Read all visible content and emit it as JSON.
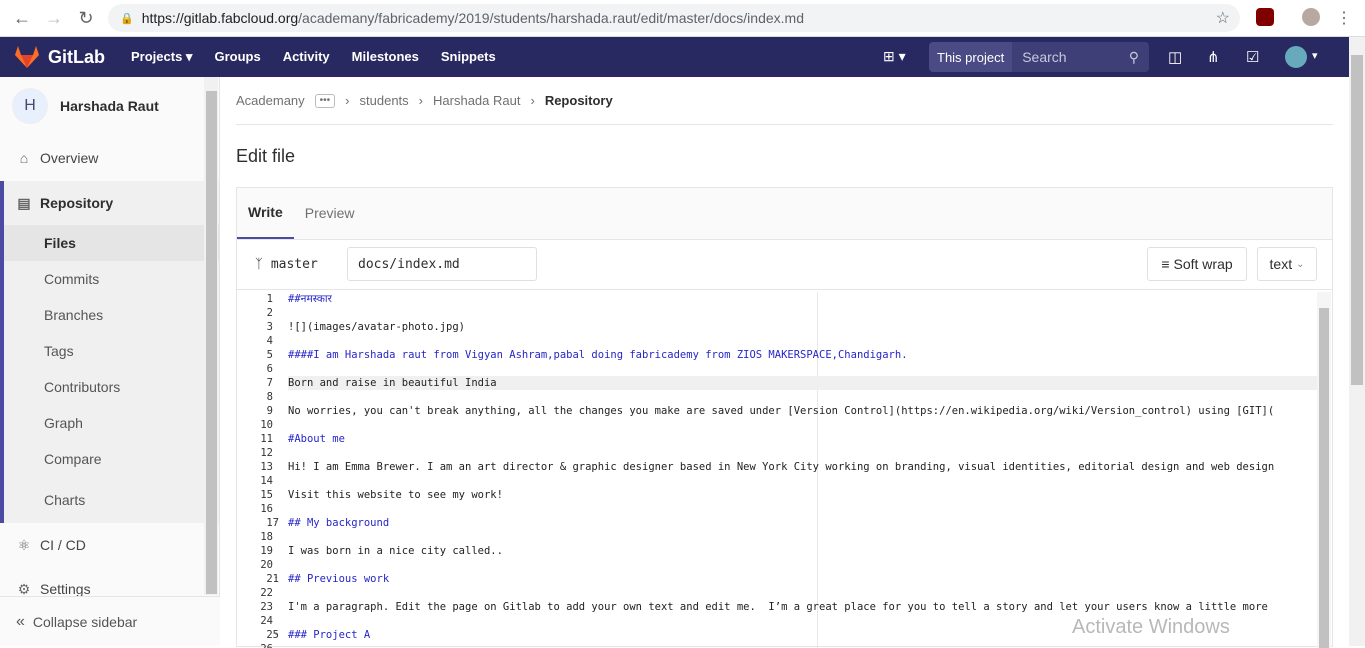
{
  "browser": {
    "url_host": "https://gitlab.fabcloud.org",
    "url_path": "/academany/fabricademy/2019/students/harshada.raut/edit/master/docs/index.md"
  },
  "gitlab": {
    "brand": "GitLab",
    "nav": [
      "Projects",
      "Groups",
      "Activity",
      "Milestones",
      "Snippets"
    ],
    "search_scope": "This project",
    "search_placeholder": "Search",
    "bar_color": "#292961"
  },
  "sidebar": {
    "avatar_letter": "H",
    "project_name": "Harshada Raut",
    "overview": "Overview",
    "repository": "Repository",
    "repo_items": [
      "Files",
      "Commits",
      "Branches",
      "Tags",
      "Contributors",
      "Graph",
      "Compare",
      "Charts"
    ],
    "cicd": "CI / CD",
    "settings": "Settings",
    "collapse": "Collapse sidebar"
  },
  "breadcrumb": {
    "items": [
      "Academany",
      "students",
      "Harshada Raut"
    ],
    "current": "Repository"
  },
  "page_title": "Edit file",
  "editor": {
    "tabs": [
      "Write",
      "Preview"
    ],
    "branch": "master",
    "filename": "docs/index.md",
    "soft_wrap": "Soft wrap",
    "file_type": "text",
    "lines": [
      "##नमस्कार",
      "",
      "![](images/avatar-photo.jpg)",
      "",
      "####I am Harshada raut from Vigyan Ashram,pabal doing fabricademy from ZIOS MAKERSPACE,Chandigarh.",
      "",
      "Born and raise in beautiful India",
      "",
      "No worries, you can't break anything, all the changes you make are saved under [Version Control](https://en.wikipedia.org/wiki/Version_control) using [GIT](",
      "",
      "#About me",
      "",
      "Hi! I am Emma Brewer. I am an art director & graphic designer based in New York City working on branding, visual identities, editorial design and web design",
      "",
      "Visit this website to see my work!",
      "",
      "## My background",
      "",
      "I was born in a nice city called..",
      "",
      "## Previous work",
      "",
      "I'm a paragraph. Edit the page on Gitlab to add your own text and edit me.  I’m a great place for you to tell a story and let your users know a little more",
      "",
      "### Project A"
    ],
    "line_numbers": [
      "1",
      "2",
      "3",
      "4",
      "5",
      "6",
      "7",
      "8",
      "9",
      "10",
      "11",
      "12",
      "13",
      "14",
      "15",
      "16",
      "17",
      "18",
      "19",
      "20",
      "21",
      "22",
      "23",
      "24",
      "25",
      "26"
    ]
  },
  "watermark": "Activate Windows"
}
